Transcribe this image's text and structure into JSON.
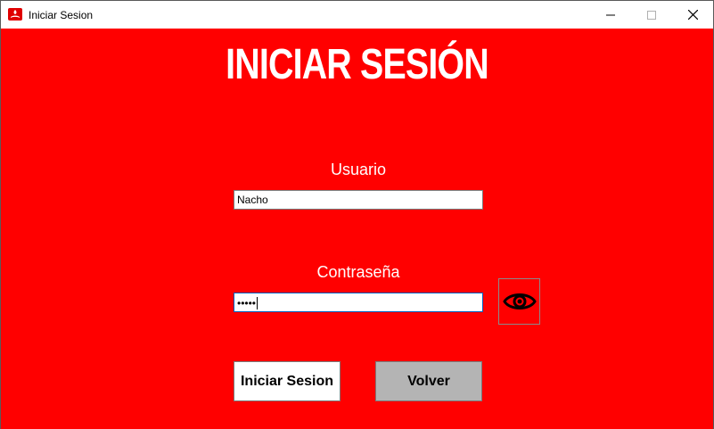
{
  "window": {
    "title": "Iniciar Sesion",
    "icon": "santander-flame-icon",
    "controls": [
      "minimize-icon",
      "maximize-icon",
      "close-icon"
    ]
  },
  "colors": {
    "background": "#ff0000",
    "heading": "#ffffff",
    "secondary_button": "#b4b4b4"
  },
  "heading": "INICIAR SESIÓN",
  "form": {
    "user_label": "Usuario",
    "user_value": "Nacho",
    "password_label": "Contraseña",
    "password_value": "•••••",
    "toggle_visibility_icon": "eye-icon"
  },
  "buttons": {
    "login_label": "Iniciar Sesion",
    "back_label": "Volver"
  }
}
